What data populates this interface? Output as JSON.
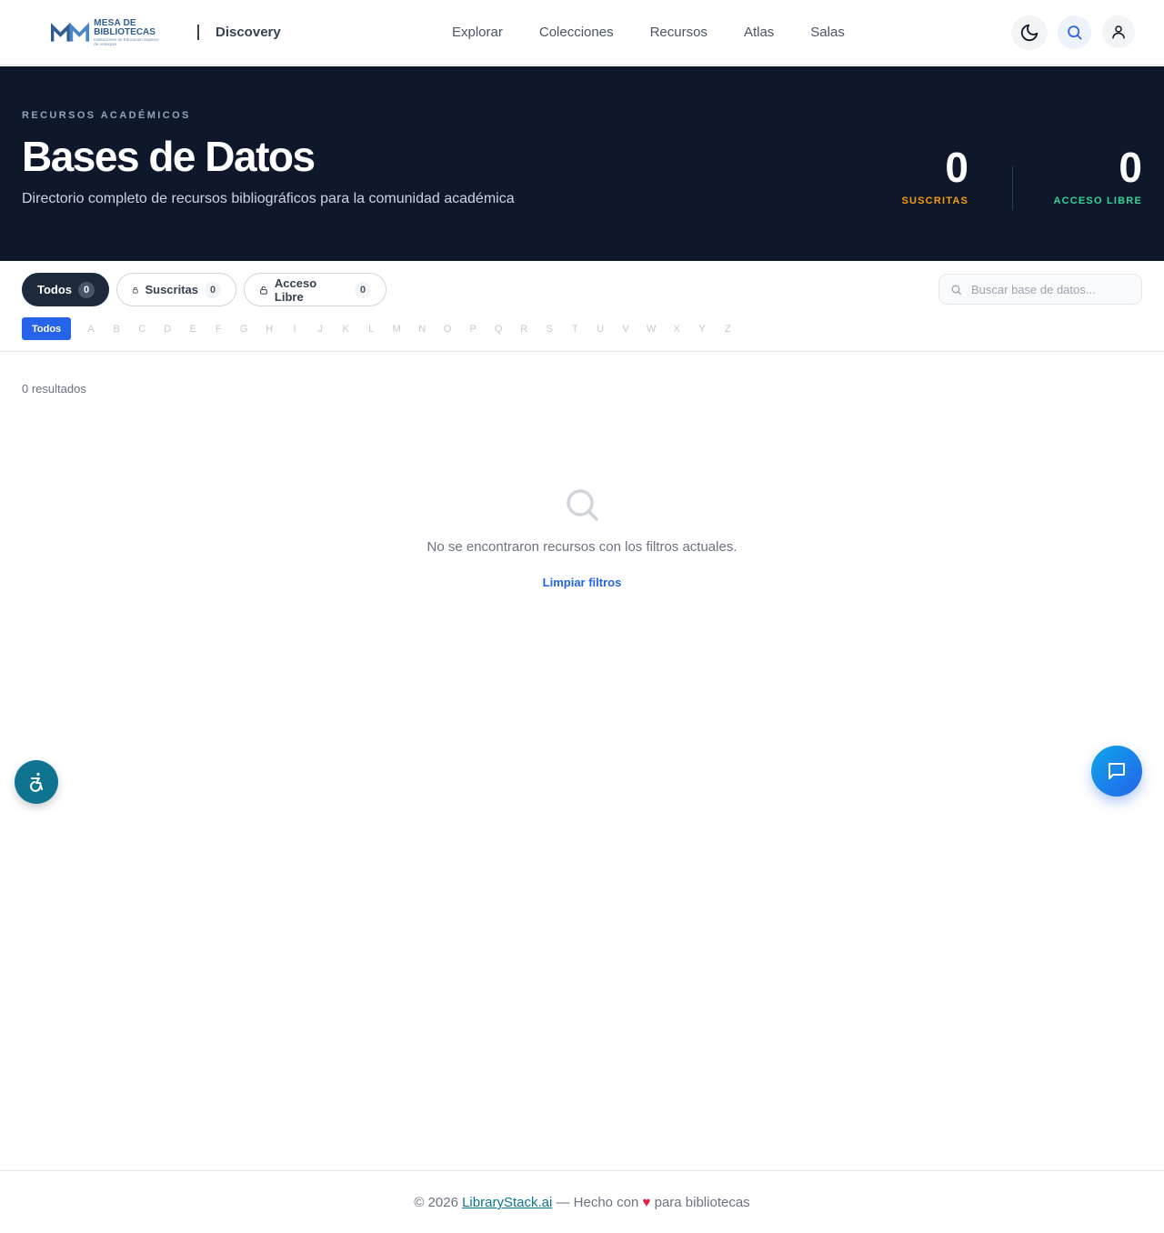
{
  "header": {
    "logo_line1": "MESA DE",
    "logo_line2": "BIBLIOTECAS",
    "logo_line3": "Instituciones de Educación Superior de Antioquia",
    "brand_sub": "Discovery",
    "nav": [
      "Explorar",
      "Colecciones",
      "Recursos",
      "Atlas",
      "Salas"
    ],
    "icons": [
      "moon-icon",
      "search-icon",
      "user-icon"
    ]
  },
  "hero": {
    "eyebrow": "RECURSOS ACADÉMICOS",
    "title": "Bases de Datos",
    "description": "Directorio completo de recursos bibliográficos para la comunidad académica",
    "stats": [
      {
        "value": "0",
        "label": "SUSCRITAS",
        "color": "#f59e0b"
      },
      {
        "value": "0",
        "label": "ACCESO LIBRE",
        "color": "#34d399"
      }
    ]
  },
  "filters": {
    "chips": [
      {
        "label": "Todos",
        "count": "0",
        "active": true
      },
      {
        "label": "Suscritas",
        "count": "0",
        "active": false
      },
      {
        "label": "Acceso Libre",
        "count": "0",
        "active": false
      }
    ],
    "search_placeholder": "Buscar base de datos...",
    "alpha_all": "Todos",
    "letters": [
      "A",
      "B",
      "C",
      "D",
      "E",
      "F",
      "G",
      "H",
      "I",
      "J",
      "K",
      "L",
      "M",
      "N",
      "O",
      "P",
      "Q",
      "R",
      "S",
      "T",
      "U",
      "V",
      "W",
      "X",
      "Y",
      "Z"
    ]
  },
  "results": {
    "count_text": "0 resultados",
    "empty_message": "No se encontraron recursos con los filtros actuales.",
    "clear_link": "Limpiar filtros"
  },
  "footer": {
    "prefix": "© 2026 ",
    "link": "LibraryStack.ai",
    "middle": " — Hecho con ",
    "heart": "♥",
    "suffix": " para bibliotecas"
  },
  "colors": {
    "hero_bg": "#0f172a",
    "accent_blue": "#2563eb",
    "accessibility_fab": "#0e7490"
  }
}
